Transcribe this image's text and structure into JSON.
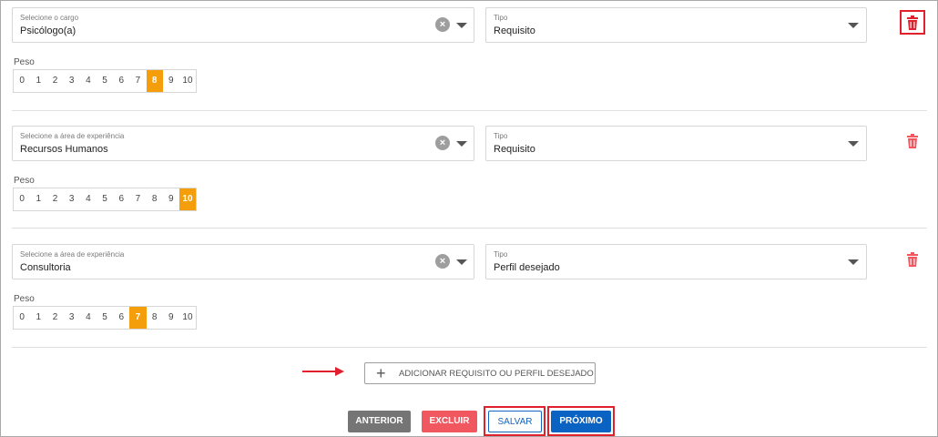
{
  "items": [
    {
      "select_label": "Selecione o cargo",
      "select_value": "Psicólogo(a)",
      "clear_symbol": "×",
      "tipo_label": "Tipo",
      "tipo_value": "Requisito",
      "peso_label": "Peso",
      "peso_selected": 8,
      "trash_highlighted": true
    },
    {
      "select_label": "Selecione a área de experiência",
      "select_value": "Recursos Humanos",
      "clear_symbol": "×",
      "tipo_label": "Tipo",
      "tipo_value": "Requisito",
      "peso_label": "Peso",
      "peso_selected": 10,
      "trash_highlighted": false
    },
    {
      "select_label": "Selecione a área de experiência",
      "select_value": "Consultoria",
      "clear_symbol": "×",
      "tipo_label": "Tipo",
      "tipo_value": "Perfil desejado",
      "peso_label": "Peso",
      "peso_selected": 7,
      "trash_highlighted": false
    }
  ],
  "peso_scale": [
    "0",
    "1",
    "2",
    "3",
    "4",
    "5",
    "6",
    "7",
    "8",
    "9",
    "10"
  ],
  "add_button": {
    "icon": "plus-icon",
    "plus_symbol": "+",
    "label": "ADICIONAR REQUISITO OU PERFIL DESEJADO"
  },
  "footer": {
    "anterior_label": "ANTERIOR",
    "excluir_label": "EXCLUIR",
    "salvar_label": "SALVAR",
    "proximo_label": "PRÓXIMO"
  },
  "colors": {
    "accent_orange": "#f59e0b",
    "delete_red": "#e0202c",
    "primary_blue": "#0a63c2",
    "secondary_gray": "#757575",
    "excluir_red": "#f0575f"
  }
}
